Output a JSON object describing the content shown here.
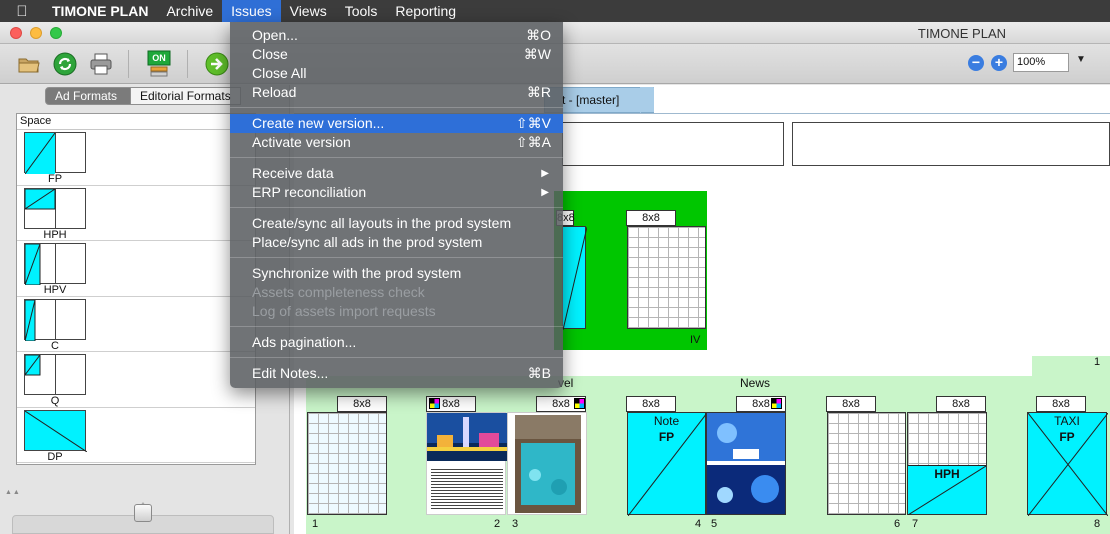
{
  "menubar": {
    "app": "TIMONE PLAN",
    "items": [
      "Archive",
      "Issues",
      "Views",
      "Tools",
      "Reporting"
    ],
    "active": "Issues"
  },
  "window": {
    "title": "TIMONE PLAN"
  },
  "toolbar": {
    "on_badge": "ON",
    "zoom_value": "100%",
    "icons": [
      "folder-icon",
      "refresh-icon",
      "printer-icon",
      "on-icon",
      "go-arrow-icon",
      "zoom-minus-icon",
      "zoom-plus-icon",
      "chevron-down-icon"
    ]
  },
  "sidebar": {
    "tabs": [
      "Ad Formats",
      "Editorial Formats"
    ],
    "active_tab": "Ad Formats",
    "list_header": "Space",
    "formats": [
      "FP",
      "HPH",
      "HPV",
      "C",
      "Q",
      "DP"
    ]
  },
  "document": {
    "tab_label": "t - [master]",
    "spreads": {
      "top": {
        "format": "8x8",
        "label": "IV"
      },
      "row_number": "1",
      "section_labels": [
        "vel",
        "News"
      ],
      "format_tag": "8x8",
      "pages": [
        "1",
        "2",
        "3",
        "4",
        "5",
        "6",
        "7",
        "8"
      ],
      "ad_captions": {
        "note": "Note",
        "fp": "FP",
        "hph": "HPH",
        "taxi": "TAXI",
        "taxi_fp": "FP"
      }
    }
  },
  "issues_menu": {
    "groups": [
      [
        {
          "label": "Open...",
          "shortcut": "⌘O"
        },
        {
          "label": "Close",
          "shortcut": "⌘W"
        },
        {
          "label": "Close All",
          "shortcut": ""
        },
        {
          "label": "Reload",
          "shortcut": "⌘R"
        }
      ],
      [
        {
          "label": "Create new version...",
          "shortcut": "⇧⌘V",
          "highlight": true
        },
        {
          "label": "Activate version",
          "shortcut": "⇧⌘A"
        }
      ],
      [
        {
          "label": "Receive data",
          "submenu": true
        },
        {
          "label": "ERP reconciliation",
          "submenu": true
        }
      ],
      [
        {
          "label": "Create/sync all layouts in the prod system"
        },
        {
          "label": "Place/sync all ads in the prod system"
        }
      ],
      [
        {
          "label": "Synchronize with the prod system"
        },
        {
          "label": "Assets completeness check",
          "disabled": true
        },
        {
          "label": "Log of assets import requests",
          "disabled": true
        }
      ],
      [
        {
          "label": "Ads pagination..."
        }
      ],
      [
        {
          "label": "Edit Notes...",
          "shortcut": "⌘B"
        }
      ]
    ]
  }
}
